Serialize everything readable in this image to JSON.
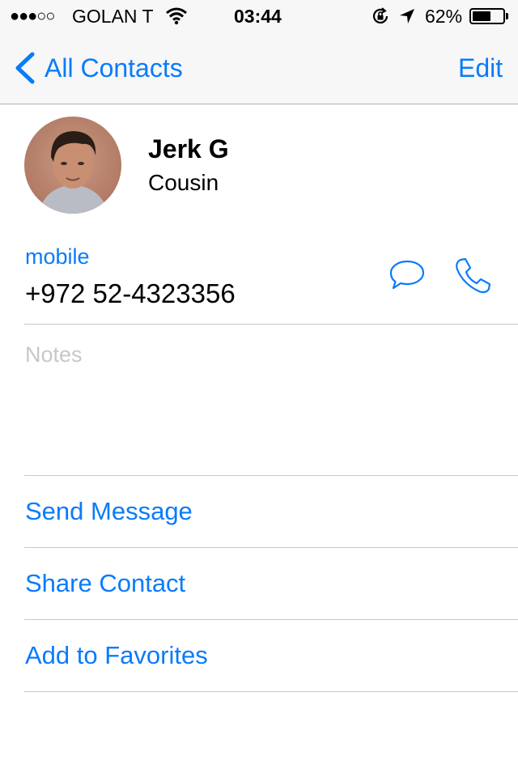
{
  "status_bar": {
    "signal_dots": "●●●○○",
    "carrier": "GOLAN T",
    "time": "03:44",
    "battery_percent": "62%",
    "battery_level": 0.62
  },
  "nav": {
    "back_label": "All Contacts",
    "edit_label": "Edit"
  },
  "contact": {
    "name": "Jerk G",
    "relation": "Cousin",
    "phone_label": "mobile",
    "phone_number": "+972 52-4323356"
  },
  "notes": {
    "placeholder": "Notes"
  },
  "actions": {
    "send_message": "Send Message",
    "share_contact": "Share Contact",
    "add_favorites": "Add to Favorites"
  },
  "colors": {
    "accent": "#0a7bfa",
    "separator": "#c8c7cc",
    "bar_bg": "#f7f7f7"
  },
  "icons": [
    "wifi-icon",
    "rotation-lock-icon",
    "location-arrow-icon",
    "battery-icon",
    "back-chevron-icon",
    "message-bubble-icon",
    "phone-icon"
  ]
}
